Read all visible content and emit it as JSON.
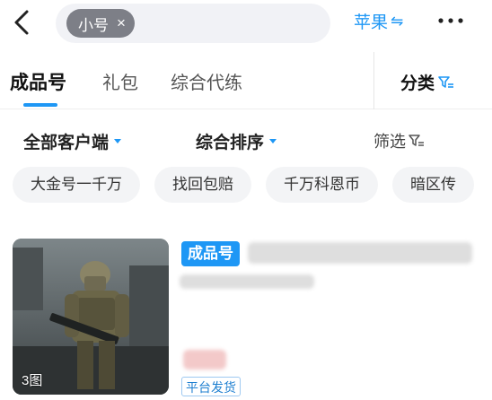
{
  "search": {
    "tag_label": "小号",
    "clear_icon": "×"
  },
  "header": {
    "platform_label": "苹果",
    "platform_icon": "⇋",
    "more_icon": "•••"
  },
  "tabs": [
    {
      "label": "成品号",
      "active": true
    },
    {
      "label": "礼包",
      "active": false
    },
    {
      "label": "综合代练",
      "active": false
    }
  ],
  "category": {
    "label": "分类"
  },
  "sort": {
    "client_label": "全部客户端",
    "order_label": "综合排序",
    "filter_label": "筛选"
  },
  "chips": [
    "大金号一千万",
    "找回包赔",
    "千万科恩币",
    "暗区传"
  ],
  "listing": {
    "image_count": "3图",
    "type_badge": "成品号",
    "shipping_tag": "平台发货"
  },
  "colors": {
    "accent": "#1e97f5",
    "tag_bg": "#7d7f87",
    "chip_bg": "#f3f4f6"
  }
}
